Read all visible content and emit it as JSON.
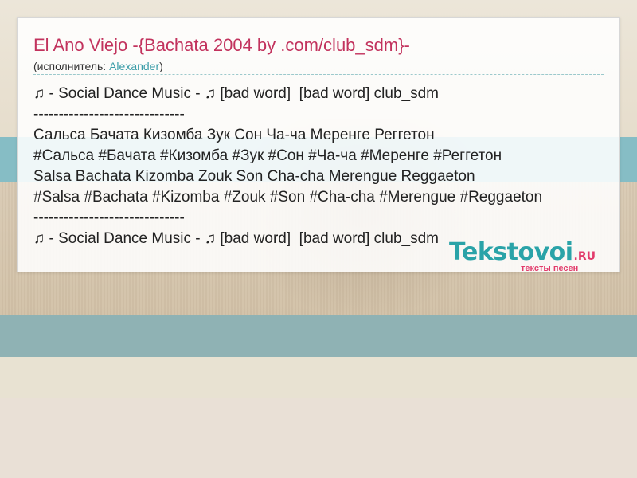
{
  "song": {
    "title": "El Ano Viejo -{Bachata 2004 by .com/club_sdm}-",
    "performer_prefix": "(исполнитель: ",
    "performer_name": "Alexander",
    "performer_suffix": ")"
  },
  "lyrics": [
    "♫ - Social Dance Music - ♫ [bad word]  [bad word] club_sdm",
    "------------------------------",
    "Сальса Бачата Кизомба Зук Сон Ча-ча Меренге Реггетон",
    "#Сальса #Бачата #Кизомба #Зук #Сон #Ча-ча #Меренге #Реггетон",
    "Salsa Bachata Kizomba Zouk Son Cha-cha Merengue Reggaeton",
    "#Salsa #Bachata #Kizomba #Zouk #Son #Cha-cha #Merengue #Reggaeton",
    "------------------------------",
    "♫ - Social Dance Music - ♫ [bad word]  [bad word] club_sdm"
  ],
  "logo": {
    "name": "Tekstovoi",
    "tld": ".RU",
    "tagline": "тексты песен"
  },
  "colors": {
    "title": "#c2325d",
    "link": "#3a9da8",
    "logo_main": "#2aa3a8",
    "logo_accent": "#e23b6b"
  }
}
